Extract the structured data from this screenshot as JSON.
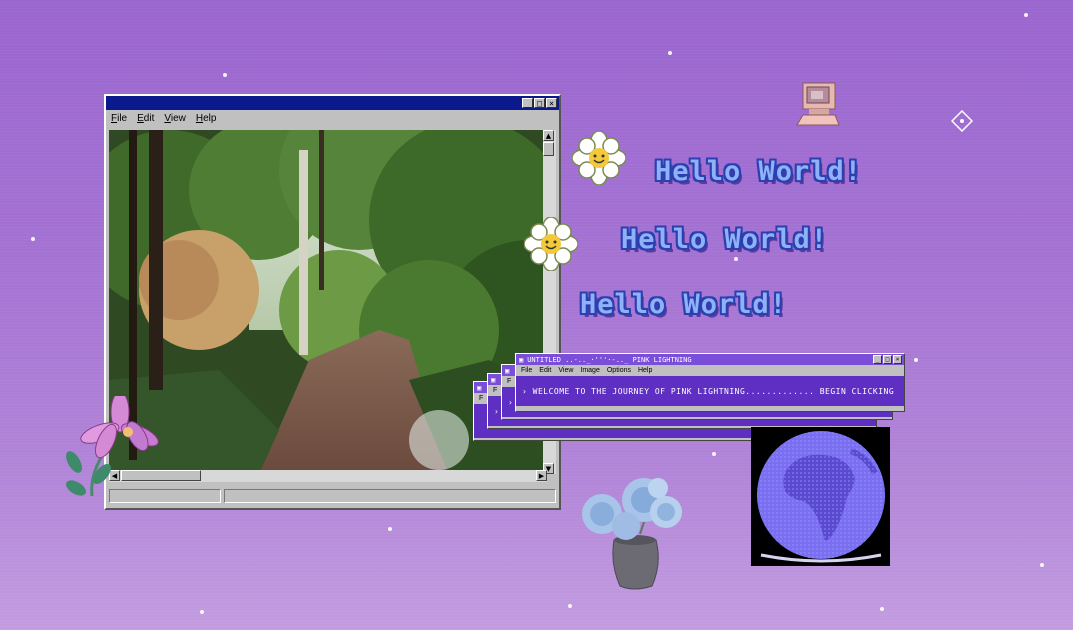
{
  "main_window": {
    "menu": [
      "File",
      "Edit",
      "View",
      "Help"
    ],
    "controls": {
      "minimize": "_",
      "maximize": "□",
      "close": "×"
    }
  },
  "greetings": [
    "Hello World!",
    "Hello World!",
    "Hello World!"
  ],
  "pink_window": {
    "title": "UNTITLED ..-.._·'''·-.._ PINK LIGHTNING",
    "menu": [
      "File",
      "Edit",
      "View",
      "Image",
      "Options",
      "Help"
    ],
    "message": "› WELCOME TO THE JOURNEY OF PINK LIGHTNING............. BEGIN CLICKING",
    "controls": {
      "minimize": "_",
      "maximize": "□",
      "close": "×"
    }
  },
  "stacked_window_menu_letter": "F",
  "stacked_window_prompt": "›",
  "colors": {
    "background": "#a472d3",
    "title_bar": "#0a1a8c",
    "pink_accent": "#5e2fc2",
    "hello_fill": "#8fb1f7",
    "hello_outline": "#2c3fb0"
  },
  "icons": [
    "retro-computer-icon",
    "diamond-sparkle-icon",
    "smiley-daisy-icon",
    "pink-lily-icon",
    "blue-roses-vase-icon",
    "globe-africa-icon"
  ]
}
